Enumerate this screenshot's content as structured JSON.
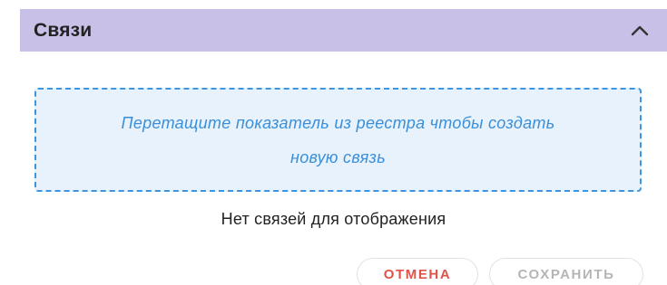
{
  "panel": {
    "title": "Связи",
    "collapse_icon": "chevron-up-icon",
    "header_color": "#c9c0e8"
  },
  "dropzone": {
    "line1": "Перетащите показатель из реестра чтобы создать",
    "line2": "новую связь",
    "border_color": "#3b95e0",
    "background_color": "#e7f2fc"
  },
  "empty_state": {
    "text": "Нет связей для отображения"
  },
  "actions": {
    "cancel_label": "ОТМЕНА",
    "save_label": "СОХРАНИТЬ",
    "cancel_color": "#e0524a",
    "save_color_disabled": "#b5b5b5"
  }
}
